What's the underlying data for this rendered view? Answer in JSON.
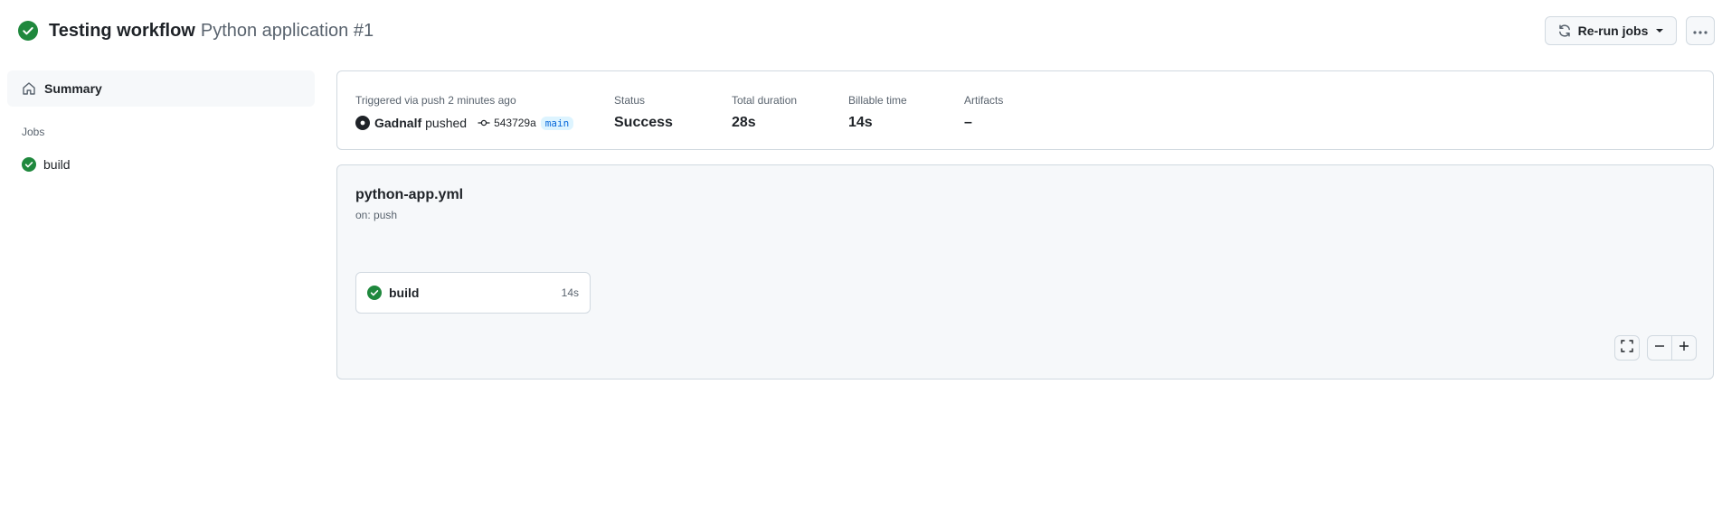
{
  "header": {
    "title": "Testing workflow",
    "subtitle": "Python application #1",
    "status_icon": "check-circle-fill-icon",
    "rerun_label": "Re-run jobs",
    "more_icon": "kebab-horizontal-icon"
  },
  "sidebar": {
    "summary_label": "Summary",
    "jobs_heading": "Jobs",
    "jobs": [
      {
        "label": "build",
        "status_icon": "check-circle-fill-icon"
      }
    ]
  },
  "summary": {
    "trigger_label": "Triggered via push 2 minutes ago",
    "actor": "Gadnalf",
    "action": "pushed",
    "commit": "543729a",
    "branch": "main",
    "status_label": "Status",
    "status_value": "Success",
    "duration_label": "Total duration",
    "duration_value": "28s",
    "billable_label": "Billable time",
    "billable_value": "14s",
    "artifacts_label": "Artifacts",
    "artifacts_value": "–"
  },
  "graph": {
    "workflow_file": "python-app.yml",
    "trigger": "on: push",
    "job": {
      "name": "build",
      "duration": "14s"
    },
    "controls": [
      "fullscreen-icon",
      "zoom-out-icon",
      "zoom-in-icon"
    ]
  },
  "colors": {
    "success": "#1f883d",
    "border": "#d1d9e0",
    "muted_text": "#59636e",
    "panel_bg": "#f6f8fa",
    "branch_bg": "#ddf4ff",
    "branch_text": "#0969da"
  }
}
